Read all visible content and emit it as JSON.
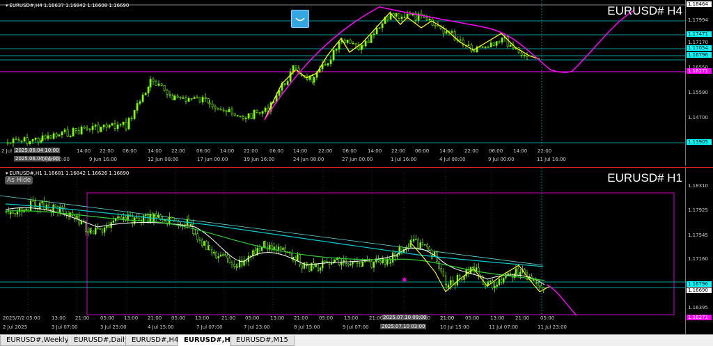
{
  "top_chart": {
    "header": "EURUSD#,H4  1.16637 1.16842 1.16608 1.16690",
    "title": "EURUSD#  H4",
    "price_labels": [
      "1.18464",
      "1.17994",
      "1.17471",
      "1.17170",
      "1.17054",
      "1.16796",
      "1.16550",
      "1.16271",
      "1.15590",
      "1.14700",
      "1.13905"
    ],
    "time_labels": [
      "2 Jul",
      "2025.06.04 10:00",
      "2025.06.04 04:00",
      "0 Jun 00:00",
      "14:00",
      "22:00",
      "06:00",
      "14:00",
      "22:00",
      "06:00",
      "14:00",
      "22:00",
      "06:00",
      "14:00",
      "22:00",
      "06:00",
      "14:00",
      "22:00",
      "06:00",
      "14:00",
      "22:00",
      "9 Jun 16:00",
      "12 Jun 08:00",
      "17 Jun 00:00",
      "19 Jun 16:00",
      "24 Jun 08:00",
      "27 Jun 00:00",
      "1 Jul 16:00",
      "4 Jul 08:00",
      "9 Jul 00:00",
      "11 Jul 16:00"
    ]
  },
  "bottom_chart": {
    "header": "EURUSD#,H1  1.16681 1.16842 1.16626 1.16690",
    "title": "EURUSD#  H1",
    "as_hide": "As Hide",
    "price_labels": [
      "1.18310",
      "1.17925",
      "1.17545",
      "1.17160",
      "1.16796",
      "1.16690",
      "1.16395",
      "1.16271"
    ],
    "time_labels": [
      "2025/7/2 05:00",
      "13:00",
      "21:00",
      "05:00",
      "13:00",
      "21:00",
      "05:00",
      "13:00",
      "21:00",
      "05:00",
      "13:00",
      "21:00",
      "05:00",
      "13:00",
      "21:00",
      "05:00",
      "13:00",
      "21:00",
      "2025.07.10 09:00",
      "21:00",
      "05:00",
      "13:00",
      "21:00",
      "05:00"
    ],
    "time_labels2": [
      "2 Jul 2025",
      "3 Jul 07:00",
      "3 Jul 23:00",
      "4 Jul 15:00",
      "7 Jul 07:00",
      "7 Jul 23:00",
      "8 Jul 15:00",
      "9 Jul 07:00",
      "2025.07.10 03:00",
      "10 Jul 15:00",
      "11 Jul 07:00",
      "11 Jul 23:00"
    ]
  },
  "tabs": [
    {
      "label": "EURUSD#,Weekly",
      "active": false
    },
    {
      "label": "EURUSD#,Daily",
      "active": false
    },
    {
      "label": "EURUSD#,H4",
      "active": false
    },
    {
      "label": "EURUSD#,H1",
      "active": true
    },
    {
      "label": "EURUSD#,M15",
      "active": false
    }
  ],
  "colors": {
    "candle": "#7fff00",
    "zigzag": "#ffff00",
    "forecast": "#ff00ff",
    "cyan_line": "#00ffff",
    "ma_white": "#ffffff",
    "ma_green": "#32cd32",
    "ma_cyan": "#00ced1",
    "magenta_tag": "#ff00ff"
  }
}
